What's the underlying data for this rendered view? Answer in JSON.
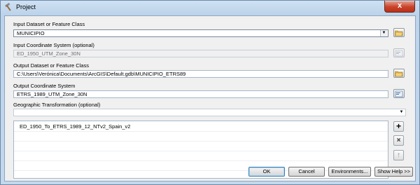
{
  "window": {
    "title": "Project",
    "close_glyph": "x",
    "icon": "hammer-icon"
  },
  "form": {
    "input_dataset_label": "Input Dataset or Feature Class",
    "input_dataset_value": "MUNICIPIO",
    "input_cs_label": "Input Coordinate System (optional)",
    "input_cs_value": "ED_1950_UTM_Zone_30N",
    "output_dataset_label": "Output Dataset or Feature Class",
    "output_dataset_value": "C:\\Users\\Verónica\\Documents\\ArcGIS\\Default.gdb\\MUNICIPIO_ETRS89",
    "output_cs_label": "Output Coordinate System",
    "output_cs_value": "ETRS_1989_UTM_Zone_30N",
    "geo_transform_label": "Geographic Transformation (optional)",
    "geo_transform_value": ""
  },
  "transform_list": {
    "items": [
      "ED_1950_To_ETRS_1989_12_NTv2_Spain_v2"
    ],
    "add_glyph": "+",
    "remove_glyph": "×",
    "up_glyph": "↑"
  },
  "buttons": {
    "ok": "OK",
    "cancel": "Cancel",
    "environments": "Environments...",
    "show_help": "Show Help >>"
  },
  "colors": {
    "title_bar": "#c4d8ec",
    "close_button": "#c9432b",
    "default_button_border": "#3c7fb1"
  }
}
